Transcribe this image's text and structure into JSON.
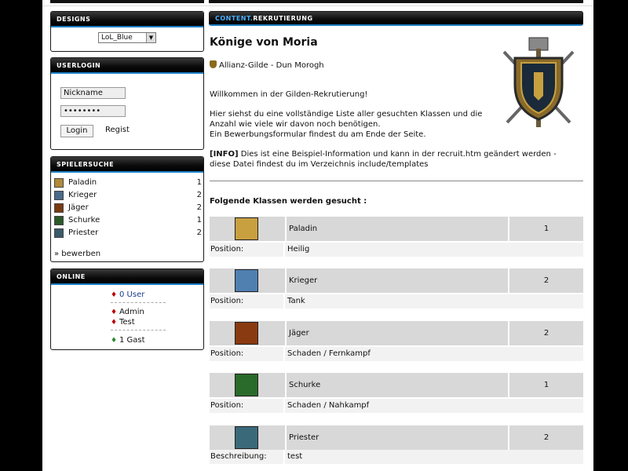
{
  "sidebar": {
    "designs": {
      "title": "DESIGNS",
      "selected": "LoL_Blue"
    },
    "userlogin": {
      "title": "USERLOGIN",
      "nickname_value": "Nickname",
      "password_value": "••••••••",
      "login_label": "Login",
      "register_label": "Regist"
    },
    "spielersuche": {
      "title": "SPIELERSUCHE",
      "items": [
        {
          "name": "Paladin",
          "count": "1",
          "color": "#b08a3a"
        },
        {
          "name": "Krieger",
          "count": "2",
          "color": "#4a6a8a"
        },
        {
          "name": "Jäger",
          "count": "2",
          "color": "#7a3a10"
        },
        {
          "name": "Schurke",
          "count": "1",
          "color": "#2a5a2a"
        },
        {
          "name": "Priester",
          "count": "2",
          "color": "#3a5a6a"
        }
      ],
      "apply_label": "» bewerben"
    },
    "online": {
      "title": "ONLINE",
      "users_label": "0 User",
      "members": [
        "Admin",
        "Test"
      ],
      "guests_label": "1 Gast"
    }
  },
  "main": {
    "header_accent": "CONTENT.",
    "header_title": "REKRUTIERUNG",
    "guild_name": "Könige von Moria",
    "guild_info": "Allianz-Gilde - Dun Morogh",
    "welcome": "Willkommen in der Gilden-Rekrutierung!",
    "intro_line1": "Hier siehst du eine vollständige Liste aller gesuchten Klassen und die",
    "intro_line2": "Anzahl wie viele wir davon noch benötigen.",
    "intro_line3": "Ein Bewerbungsformular findest du am Ende der Seite.",
    "info_tag": "[INFO]",
    "info_text": " Dies ist eine Beispiel-Information und kann in der recruit.htm geändert werden - diese Datei findest du im Verzeichnis include/templates",
    "classes_heading": "Folgende Klassen werden gesucht :",
    "classes": [
      {
        "name": "Paladin",
        "count": "1",
        "pos_label": "Position:",
        "pos_value": "Heilig",
        "color": "#c8a040"
      },
      {
        "name": "Krieger",
        "count": "2",
        "pos_label": "Position:",
        "pos_value": "Tank",
        "color": "#5080b0"
      },
      {
        "name": "Jäger",
        "count": "2",
        "pos_label": "Position:",
        "pos_value": "Schaden / Fernkampf",
        "color": "#8a3a10"
      },
      {
        "name": "Schurke",
        "count": "1",
        "pos_label": "Position:",
        "pos_value": "Schaden / Nahkampf",
        "color": "#2a6a2a"
      },
      {
        "name": "Priester",
        "count": "2",
        "pos_label": "Beschreibung:",
        "pos_value": "test",
        "color": "#3a6a7a"
      }
    ]
  },
  "colors": {
    "accent": "#1e7fc4",
    "header_bg": "#0b0b0b",
    "row_bg": "#d8d8d8"
  }
}
